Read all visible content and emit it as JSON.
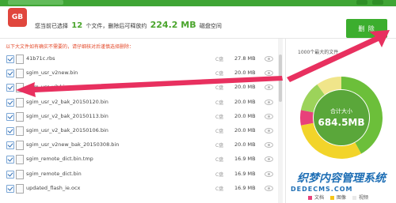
{
  "header": {
    "logo_text": "GB",
    "summary_prefix": "您当前已选择",
    "file_count": "12",
    "summary_middle": "个文件，删除后可释放约",
    "space": "224.2 MB",
    "summary_suffix": "磁盘空间",
    "delete_label": "删 除"
  },
  "list": {
    "notice": "以下大文件如有确实不需要的，请仔细核对后谨慎选择删除：",
    "rows": [
      {
        "name": "41b71c.rbs",
        "drive": "C盘",
        "size": "27.8 MB"
      },
      {
        "name": "sgim_usr_v2new.bin",
        "drive": "C盘",
        "size": "20.0 MB"
      },
      {
        "name": "sgim_usr_v2.bin",
        "drive": "C盘",
        "size": "20.0 MB"
      },
      {
        "name": "sgim_usr_v2_bak_20150120.bin",
        "drive": "C盘",
        "size": "20.0 MB"
      },
      {
        "name": "sgim_usr_v2_bak_20150113.bin",
        "drive": "C盘",
        "size": "20.0 MB"
      },
      {
        "name": "sgim_usr_v2_bak_20150106.bin",
        "drive": "C盘",
        "size": "20.0 MB"
      },
      {
        "name": "sgim_usr_v2new_bak_20150308.bin",
        "drive": "C盘",
        "size": "20.0 MB"
      },
      {
        "name": "sgim_remote_dict.bin.tmp",
        "drive": "C盘",
        "size": "16.9 MB"
      },
      {
        "name": "sgim_remote_dict.bin",
        "drive": "C盘",
        "size": "16.9 MB"
      },
      {
        "name": "updated_flash_ie.ocx",
        "drive": "C盘",
        "size": "16.9 MB"
      }
    ]
  },
  "panel": {
    "title": "1000个最大的文件",
    "total_label": "合计大小",
    "total_value": "684.5MB",
    "legend": [
      {
        "label": "文档",
        "color": "#e8417a"
      },
      {
        "label": "图像",
        "color": "#f5c518"
      },
      {
        "label": "视频",
        "color": "#e8e8e8"
      }
    ],
    "ring": {
      "segments": [
        {
          "share": 0.42,
          "color": "#6cbf3a"
        },
        {
          "share": 0.3,
          "color": "#f2d42a"
        },
        {
          "share": 0.06,
          "color": "#e8417a"
        },
        {
          "share": 0.12,
          "color": "#9cd35a"
        },
        {
          "share": 0.1,
          "color": "#f0e58a"
        }
      ],
      "center_color": "#5aa73a"
    }
  },
  "watermark": {
    "line1": "织梦内容管理系统",
    "line2": "DEDECMS.COM"
  },
  "colors": {
    "accent": "#3cae2e",
    "arrow": "#e8305f",
    "notice": "#e44b2c"
  }
}
